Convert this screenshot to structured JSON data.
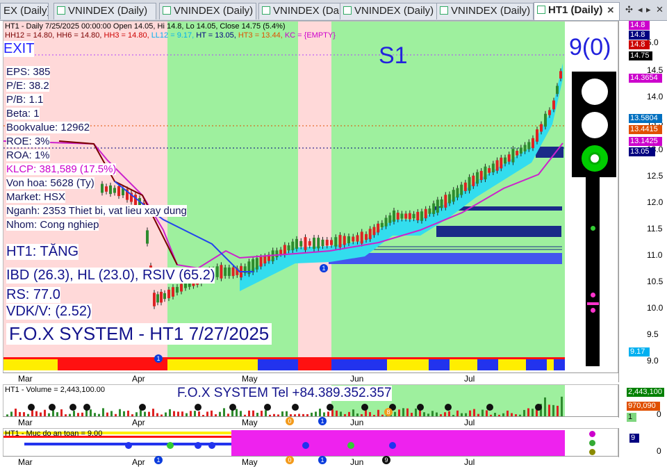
{
  "tabs": [
    {
      "label": "EX (Daily)"
    },
    {
      "label": "VNINDEX (Daily)"
    },
    {
      "label": "VNINDEX (Daily)"
    },
    {
      "label": "VNINDEX (Daily)"
    },
    {
      "label": "VNINDEX (Daily)"
    },
    {
      "label": "VNINDEX (Daily)"
    },
    {
      "label": "HT1 (Daily)",
      "active": true
    }
  ],
  "header": {
    "line1": "HT1 - Daily 7/25/2025 00:00:00 Open 14.05, Hi 14.8, Lo 14.05, Close 14.75 (5.4%)",
    "line2": [
      {
        "text": "HH12 = 14.80, ",
        "color": "#7a0000"
      },
      {
        "text": "HH6 = 14.80, ",
        "color": "#7a0000"
      },
      {
        "text": "HH3 = 14.80, ",
        "color": "#cc0000"
      },
      {
        "text": "LL12 = 9.17, ",
        "color": "#00b0f0"
      },
      {
        "text": "HT  = 13.05, ",
        "color": "#000080"
      },
      {
        "text": "HT3  = 13.44, ",
        "color": "#e05000"
      },
      {
        "text": "KC = {EMPTY}",
        "color": "#cc00cc"
      }
    ]
  },
  "overlay": {
    "exit": "EXIT",
    "s1": "S1",
    "count": "9(0)",
    "stats": [
      "EPS: 385",
      "P/E: 38.2",
      "P/B: 1.1",
      "Beta: 1",
      "Bookvalue: 12962",
      "ROE: 3%",
      "ROA: 1%"
    ],
    "klcp": "KLCP: 381,589 (17.5%)",
    "stats2": [
      "Von hoa: 5628 (Ty)",
      "Market: HSX",
      "Nganh: 2353 Thiet bi, vat lieu xay dung",
      "Nhom: Cong nghiep"
    ],
    "trend": "HT1: TĂNG",
    "ibd": "IBD (26.3), HL (23.0), RSIV (65.2)",
    "rs": "RS: 77.0",
    "vdk": "VDK/V:  (2.52)",
    "brand": "F.O.X SYSTEM - HT1 7/27/2025",
    "phone": "F.O.X SYSTEM Tel +84.389.352.357"
  },
  "price_axis": {
    "ticks": [
      "14.5",
      "14.0",
      "13.5",
      "13.0",
      "12.5",
      "12.0",
      "11.5",
      "11.0",
      "10.5",
      "10.0",
      "9.5",
      "9.0"
    ],
    "top": "5.0",
    "tags": [
      {
        "text": "14.8",
        "color": "#cc00cc"
      },
      {
        "text": "14.8",
        "color": "#000080"
      },
      {
        "text": "14.8",
        "color": "#cc0000"
      },
      {
        "text": "14.75",
        "color": "#000000"
      },
      {
        "text": "14.3654",
        "color": "#cc00cc"
      },
      {
        "text": "13.5804",
        "color": "#0070c0"
      },
      {
        "text": "13.4415",
        "color": "#e05000"
      },
      {
        "text": "13.1425",
        "color": "#cc00cc"
      },
      {
        "text": "13.05",
        "color": "#000080"
      },
      {
        "text": "9.17",
        "color": "#00b0f0"
      }
    ]
  },
  "months": [
    "Mar",
    "Apr",
    "May",
    "Jun",
    "Jul"
  ],
  "volume": {
    "title": "HT1 - Volume = 2,443,100.00",
    "tags": [
      {
        "text": "2,443,100",
        "color": "#008000"
      },
      {
        "text": "970,090",
        "color": "#e05000"
      },
      {
        "text": "1",
        "color": "#7fd67f"
      }
    ],
    "zero": "0"
  },
  "safety": {
    "title": "HT1 - Muc do an toan = 9.00",
    "tag": "9",
    "zero": "0"
  },
  "markers": {
    "m1": "1",
    "m0": "0",
    "m8": "8",
    "m9": "9"
  }
}
